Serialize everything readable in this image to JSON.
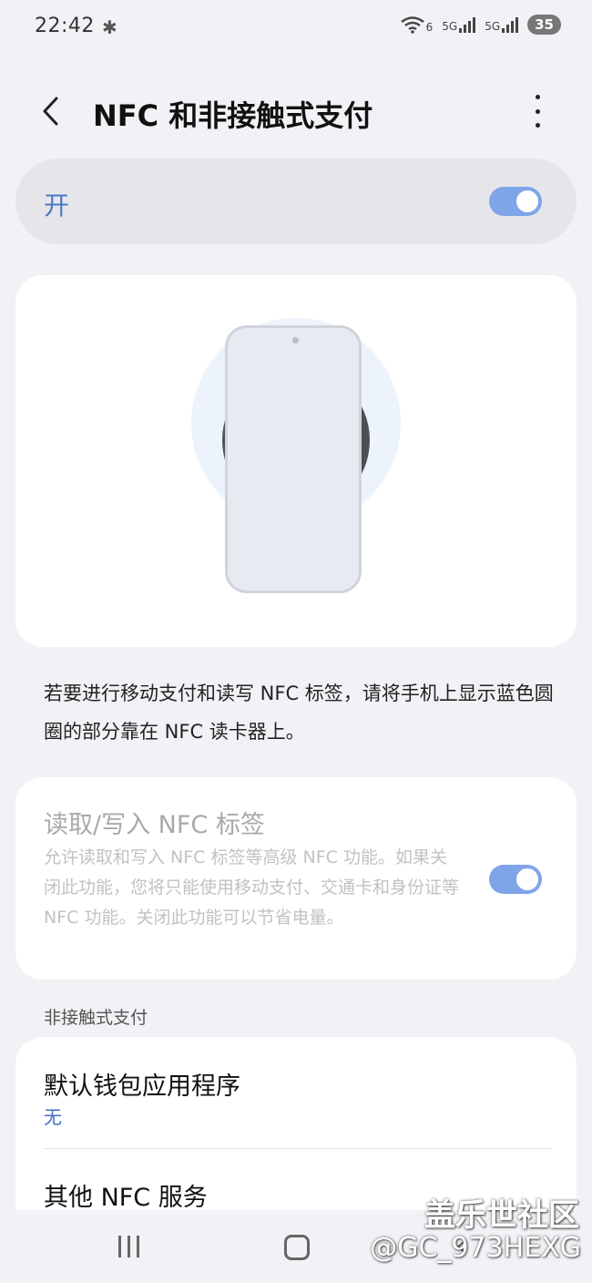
{
  "status_bar": {
    "time": "22:42",
    "bluetooth_icon": "bluetooth-icon",
    "wifi_label": "6",
    "sim1_label": "5G",
    "sim2_label": "5G",
    "battery": "35"
  },
  "app_bar": {
    "back_icon": "chevron-left-icon",
    "title": "NFC 和非接触式支付",
    "more_icon": "more-vertical-icon"
  },
  "master_switch": {
    "label": "开",
    "state": true
  },
  "description": "若要进行移动支付和读写 NFC 标签，请将手机上显示蓝色圆圈的部分靠在 NFC 读卡器上。",
  "read_write": {
    "title": "读取/写入 NFC 标签",
    "summary": "允许读取和写入 NFC 标签等高级 NFC 功能。如果关闭此功能，您将只能使用移动支付、交通卡和身份证等 NFC 功能。关闭此功能可以节省电量。",
    "state": true
  },
  "section_header": "非接触式支付",
  "payment": {
    "default_wallet_title": "默认钱包应用程序",
    "default_wallet_value": "无",
    "other_services_title": "其他 NFC 服务"
  },
  "watermark": {
    "line1": "盖乐世社区",
    "line2": "@GC_973HEXG"
  },
  "colors": {
    "accent": "#4a78c7",
    "switch_on": "#7fa4e8",
    "background": "#f2f2f6"
  }
}
